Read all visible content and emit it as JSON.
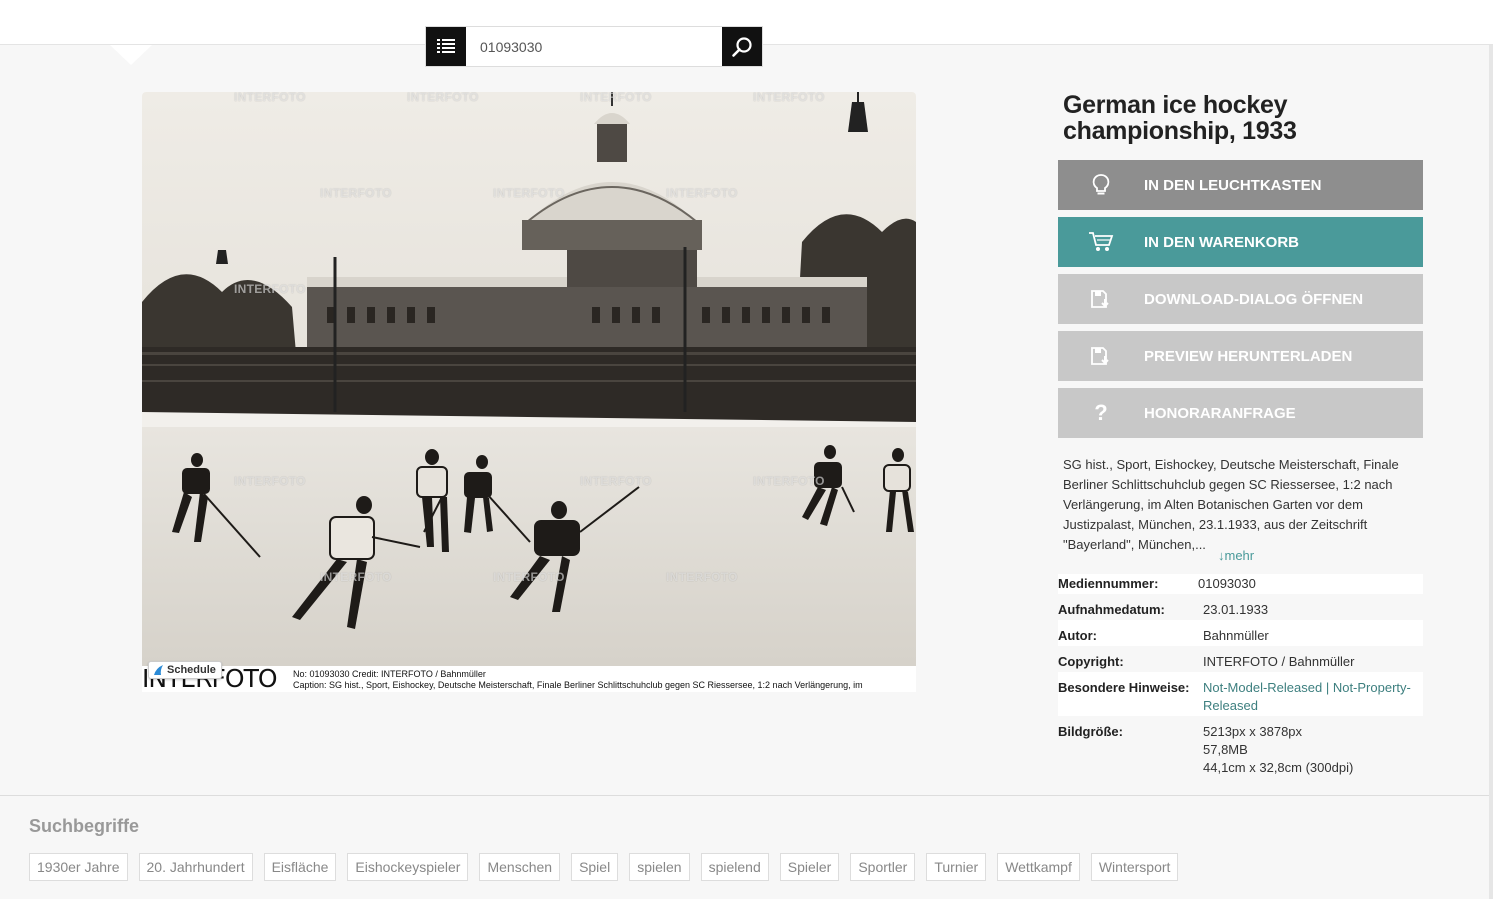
{
  "search": {
    "value": "01093030",
    "list_icon": "list-icon",
    "search_icon": "search-icon"
  },
  "image": {
    "watermark": "INTERFOTO",
    "footer_logo": "INTERFOTO",
    "footer_line1": "No: 01093030 Credit: INTERFOTO / Bahnmüller",
    "footer_line2": "Caption: SG hist., Sport, Eishockey, Deutsche Meisterschaft, Finale Berliner Schlittschuhclub gegen SC Riessersee, 1:2 nach Verlängerung, im",
    "schedule_label": "Schedule"
  },
  "title": "German ice hockey championship, 1933",
  "actions": [
    {
      "label": "IN DEN LEUCHTKASTEN",
      "icon": "lightbulb-icon",
      "color": "#8e8e8e"
    },
    {
      "label": "IN DEN WARENKORB",
      "icon": "cart-icon",
      "color": "#4a9a9a"
    },
    {
      "label": "DOWNLOAD-DIALOG ÖFFNEN",
      "icon": "download-icon",
      "color": "#c8c8c8"
    },
    {
      "label": "PREVIEW HERUNTERLADEN",
      "icon": "download-icon",
      "color": "#c8c8c8"
    },
    {
      "label": "HONORARANFRAGE",
      "icon": "question-icon",
      "color": "#c8c8c8"
    }
  ],
  "description": "SG hist., Sport, Eishockey, Deutsche Meisterschaft, Finale Berliner Schlittschuhclub gegen SC Riessersee, 1:2 nach Verlängerung, im Alten Botanischen Garten vor dem Justizpalast, München, 23.1.1933, aus der Zeitschrift \"Bayerland\", München,...",
  "more_label": "↓mehr",
  "meta": [
    {
      "key": "Mediennummer:",
      "value": "01093030"
    },
    {
      "key": "Aufnahmedatum:",
      "value": "23.01.1933"
    },
    {
      "key": "Autor:",
      "value": "Bahnmüller"
    },
    {
      "key": "Copyright:",
      "value": "INTERFOTO / Bahnmüller"
    },
    {
      "key": "Besondere Hinweise:",
      "value": "Not-Model-Released | Not-Property-Released"
    },
    {
      "key": "Bildgröße:",
      "value": "5213px x 3878px",
      "value2": "57,8MB",
      "value3": "44,1cm x 32,8cm (300dpi)"
    }
  ],
  "keywords_title": "Suchbegriffe",
  "keywords": [
    "1930er Jahre",
    "20. Jahrhundert",
    "Eisfläche",
    "Eishockeyspieler",
    "Menschen",
    "Spiel",
    "spielen",
    "spielend",
    "Spieler",
    "Sportler",
    "Turnier",
    "Wettkampf",
    "Wintersport"
  ]
}
